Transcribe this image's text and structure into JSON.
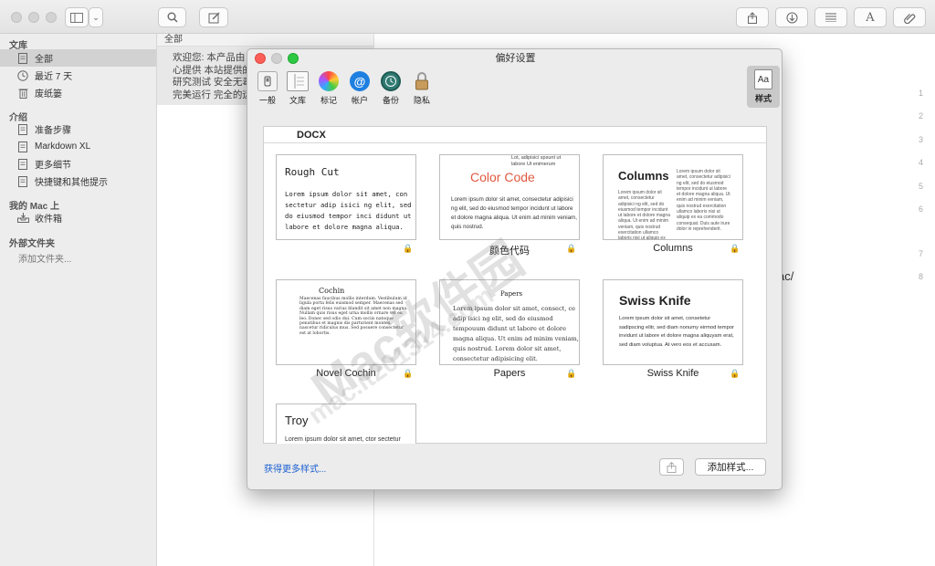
{
  "toolbar": {
    "view_icon": "sidebar-toggle-icon",
    "search_icon": "search-icon",
    "compose_icon": "compose-icon"
  },
  "sidebar": {
    "library_header": "文库",
    "library_items": [
      {
        "label": "全部",
        "icon": "doc-icon"
      },
      {
        "label": "最近 7 天",
        "icon": "clock-icon"
      },
      {
        "label": "废纸篓",
        "icon": "trash-icon"
      }
    ],
    "intro_header": "介绍",
    "intro_items": [
      {
        "label": "准备步骤"
      },
      {
        "label": "Markdown XL"
      },
      {
        "label": "更多细节"
      },
      {
        "label": "快捷键和其他提示"
      }
    ],
    "mac_header": "我的 Mac 上",
    "mac_items": [
      {
        "label": "收件箱"
      }
    ],
    "ext_header": "外部文件夹",
    "ext_add": "添加文件夹..."
  },
  "list": {
    "header": "全部",
    "item_lines": [
      "欢迎您: 本产品由",
      "心提供 本站提供的",
      "研究测试 安全无毒",
      "完美运行 完全的运"
    ]
  },
  "editor": {
    "line_numbers": [
      "1",
      "2",
      "3",
      "4",
      "5",
      "6",
      "7",
      "8"
    ],
    "text_fragment": "ac/"
  },
  "watermark": {
    "main": "Mac软件园",
    "url": "mac.it201314.com"
  },
  "dialog": {
    "title": "偏好设置",
    "tabs": [
      {
        "label": "一般"
      },
      {
        "label": "文库"
      },
      {
        "label": "标记"
      },
      {
        "label": "帐户"
      },
      {
        "label": "备份"
      },
      {
        "label": "隐私"
      },
      {
        "label": "样式"
      }
    ],
    "panel_header": "DOCX",
    "styles": [
      {
        "label": "",
        "title": "Rough Cut",
        "body": "Lorem ipsum dolor sit amet, con sectetur adip isici ng elit, sed do eiusmod tempor inci didunt ut labore et dolore magna aliqua."
      },
      {
        "label": "颜色代码",
        "title": "Color Code",
        "side": "Lot, adipisici spsunt ut labore Ut enimerum",
        "body": "Lorem ipsum dolor sit amet, consectetur adipisici ng elit, sed do eiusmod tempor incidunt ut labore et dolore magna aliqua. Ut enim ad minim veniam, quis nostrud."
      },
      {
        "label": "Columns",
        "title": "Columns",
        "col_left": "Lorem ipsum dolor sit amet, consectetur adipisici ng elit, sed do eiusmod tempor incidunt ut labore et dolore magna aliqua. Ut enim ad minim veniam, quis nostrud exercitation ullamco laboris nisi ut aliquip ex ea commodo.",
        "col_right": "Lorem ipsum dolor sit amet, consectetur adipisici ng elit, sed do eiusmod tempor incidunt ut labore et dolore magna aliqua. Ut enim ad minim veniam, quis nostrud exercitation ullamco laboris nisi ut aliquip ex ea commodo consequat. Duis aute irure dolor in reprehenderit."
      },
      {
        "label": "Novel Cochin",
        "title": "Cochin",
        "body": "Maecenas faucibus mollis interdum. Vestibulum id ligula porta felis euismod semper. Maecenas sed diam eget risus varius blandit sit amet non magna. Nullam quis risus eget urna mollis ornare vel eu leo. Donec sed odio dui. Cum sociis natoque penatibus et magnis dis parturient montes, nascetur ridiculus mus. Sed posuere consectetur est at lobortis."
      },
      {
        "label": "Papers",
        "title": "Papers",
        "body": "Lorem ipsum dolor sit amet, consect, ce adip isici ng elit, sed do eiusmod tempouum didunt ut labore et dolore magna aliqua. Ut enim ad minim veniam, quis nostrud. Lorem dolor sit amet, consectetur adipisicing elit."
      },
      {
        "label": "Swiss Knife",
        "title": "Swiss Knife",
        "body": "Lorem ipsum dolor sit amet, consetetur sadipscing elitr, sed diam nonumy eirmod tempor invidunt ut labore et dolore magna aliquyam erat, sed diam voluptua. At vero eos et accusam."
      },
      {
        "label": "",
        "title": "Troy",
        "body": "Lorem ipsum dolor sit amet, ctor sectetur adipiscing elit, sed do eiusmod tempor incididunt ut labore et dolore magna aliqua."
      }
    ],
    "get_more": "获得更多样式...",
    "add_style": "添加样式..."
  }
}
